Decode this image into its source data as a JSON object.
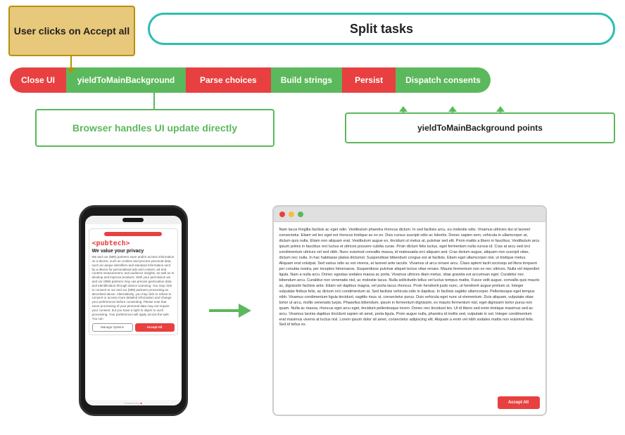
{
  "diagram": {
    "user_clicks_label": "User clicks on Accept all",
    "split_tasks_label": "Split tasks",
    "pipeline": {
      "close_ui": "Close UI",
      "yield1": "yieldToMainBackground",
      "parse_choices": "Parse choices",
      "build_strings": "Build strings",
      "persist": "Persist",
      "dispatch_consents": "Dispatch consents"
    },
    "browser_handles_label": "Browser handles UI update directly",
    "yield_points_label": "yieldToMainBackground points"
  },
  "phone": {
    "accept_bar_placeholder": "",
    "pubtech_logo": "<pubtech>",
    "privacy_title": "We value your privacy",
    "privacy_text_1": "We and our (889) partners store and/or access information on a device, such as cookies and process personal data, such as unique identifiers and standard information sent by a device for personalised ads and content, ad and content measurement, and audience insights, as well as to develop and improve products. With your permission we and our (889) partners may use precise geolocation data and identification through device scanning. You may click to consent to our and our (889) partners processing as described above. Alternatively, you may click to refuse to consent or access more detailed information and change your preferences before consenting. Please note that some processing of your personal data may not require your consent, but you have a right to object to such processing. Your preferences will apply across the web You can",
    "manage_options": "Manage Options",
    "accept_all": "Accept All",
    "footer_text": "Powered by"
  },
  "browser": {
    "lorem_text": "Nam lacus fringilla facilisis ac eget odio. Vestibulum pharetra rhoncus dictum. In sed facilisis arcu, eu molestie odio. Vivamus ultricies dui ut laoreet consectetur. Etiam vel leo eget est rhoncus tristique ac ex ex. Duis cursus suscipit odio ac lobortis. Donec sapien sem, vehicula in ullamcorper at, dictum quis nulla. Etiam non aliquam erat. Vestibulum augue ex, tincidunt ut metus at, pulvinar sed elit. Proin mattis a libero in faucibus. Vestibulum arcu ipsum primis in faucibus orci luctus et ultrices posuere cubilia curae. Proin dictum felis luctus, eget fermentum nulla cursus id. Cras at arcu sed orci condimentum ultrices vel sed nibh. Nunc euismod convallis massa, id malesuada orci aliquam sed. Cras dictum augue, aliquam non suscipit vitae, dictum nec nulla. In hac habitasse platea dictumst. Suspendisse bibendum congue est at facilisis. Etiam eget ullamcorper nisl, ut tristique metus. Aliquam erat volutpat. Sed varius odio ac est viverra, at laoreet ante iaculis. Vivamus ut arcu ornare arcu. Class aptent taciti sociosqu ad litora torquent per conubia nostra, per inceptos himenaeos. Suspendisse pulvinar aliquet lectus vitae ornare. Mauris fermentum non ex nec ultrices. Nulla vel imperdiet ligula. Nam a nulla arcu. Donec egestas sodales massa ac porta. Vivamus ultrices diam metus, vitae gravida est accumsan eget. Curabitur nec bibendum arcu. Curabitur non venenatis nisl, ac molestie lacus. Nulla sollicitudin tellus vel luctus tempus mattis. Fusce velit augue, convallis quis mauris ac, dignissim facilisis ante. Etiam vel dapibus magna, vel porta lacus rhoncus. Proin hendrerit justo nunc, ut hendrerit augue pretium ut. Integer vulputate finibus felis, ac dictum orci condimentum at. Sed facilisis vehicula odio in dapibus. In facilisis sagittis ullamcorper. Pellentesque eget tempus nibh. Vivamus condimentum ligula tincidunt, sagittis risus ut, consectetur purus. Duis vehicula eget nunc ut elementum. Duis aliquam, vulputate vitae tortor ut arcu, mollis venenatis turpis. Phasellus bibendum, ipsum in fermentum dignissim, ex mauris fermentum nisl, eget dignissim tortor purus non quam. Nulla ac massa, rhoncus eget arcu eget, tincidunt pellentesque lorem. Donec nec tincidunt leo. Ut id libero sed enim tristique maximus sed ac arcu. Vivamus lacinia dapibus tincidunt sapien sit amet, porta ligula. Proin augue nulla, pharetra id mollis sed, vulputate in est. Integer condimentum erat maximus viverra at luctus nisl. Lorem ipsum dolor sit amet, consectetur adipiscing elit. Aliquam a enim vel nibh sodales mattis non euismod felis. Sed id tellus ex.",
    "accept_overlay": "Accept All"
  }
}
